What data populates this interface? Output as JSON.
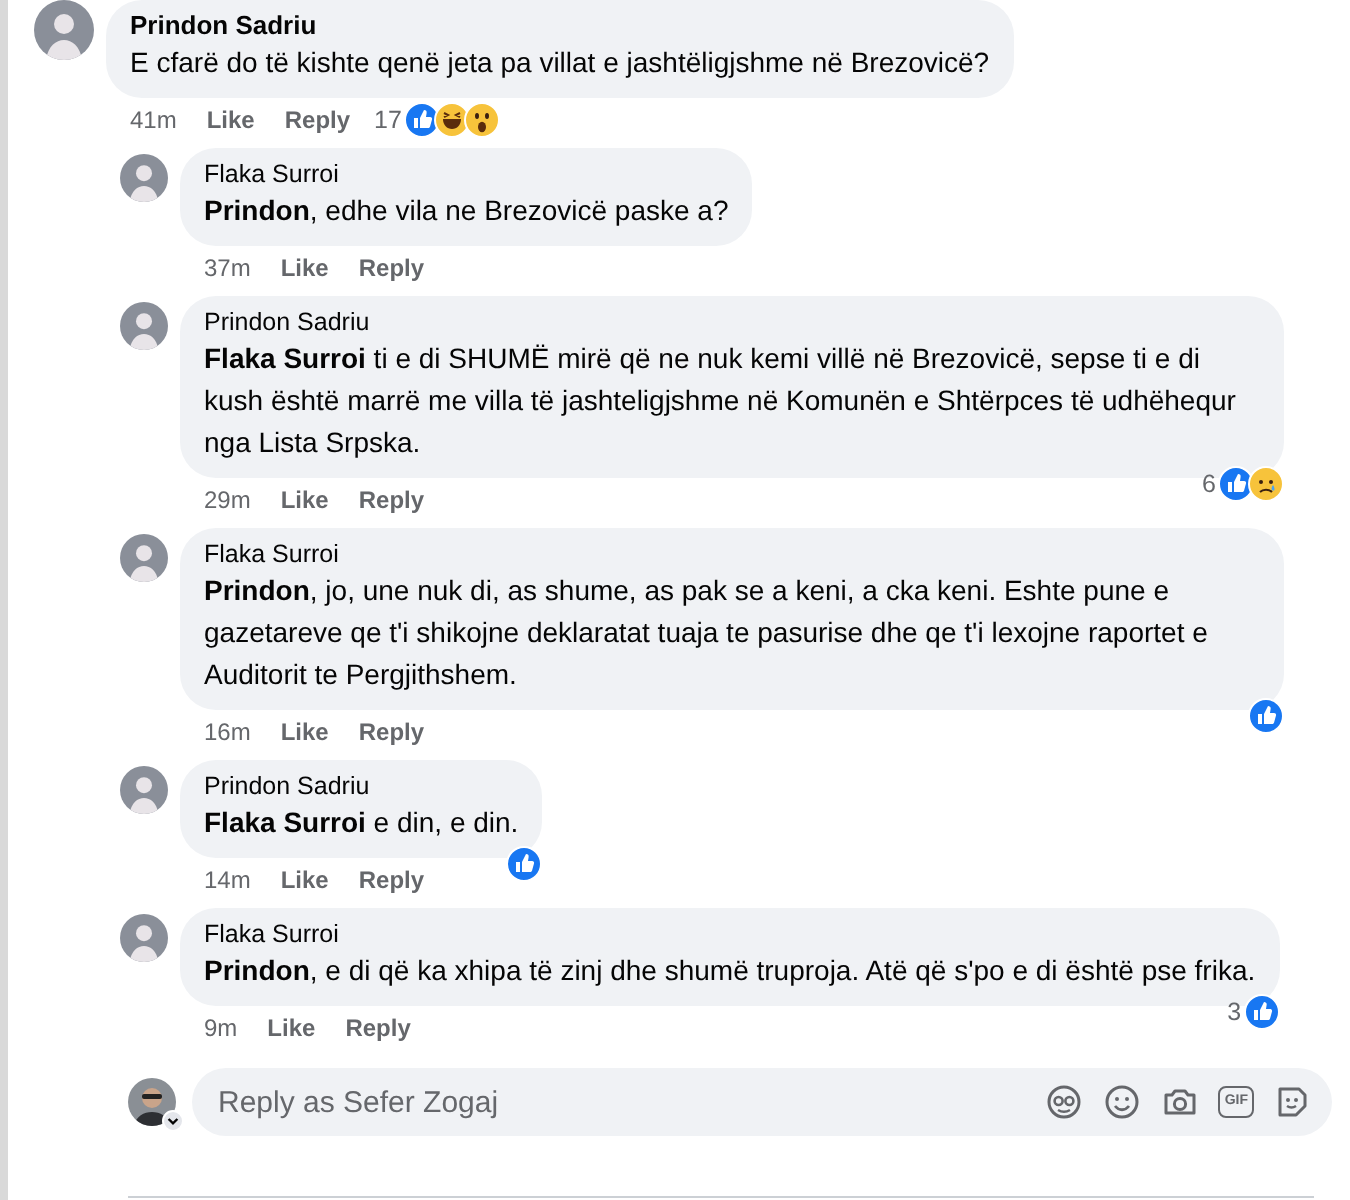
{
  "comments": [
    {
      "author": "Prindon Sadriu",
      "text": "E cfarë do të kishte qenë jeta pa villat e jashtëligjshme në Brezovicë?",
      "nested": false,
      "time": "41m",
      "actions": [
        "Like",
        "Reply"
      ],
      "reactions": {
        "count": "17",
        "icons": [
          {
            "kind": "like"
          },
          {
            "kind": "haha"
          },
          {
            "kind": "wow"
          }
        ]
      }
    },
    {
      "author": "Flaka Surroi",
      "text": "**Prindon**, edhe vila ne Brezovicë paske a?",
      "nested": true,
      "time": "37m",
      "actions": [
        "Like",
        "Reply"
      ]
    },
    {
      "author": "Prindon Sadriu",
      "text": "**Flaka Surroi** ti e di SHUMË mirë që ne nuk kemi villë në Brezovicë, sepse ti e di kush është marrë me villa të jashteligjshme në Komunën e Shtërpces të udhëhequr nga Lista Srpska.",
      "nested": true,
      "time": "29m",
      "actions": [
        "Like",
        "Reply"
      ],
      "reactions": {
        "count": "6",
        "icons": [
          {
            "kind": "like"
          },
          {
            "kind": "sad"
          }
        ]
      }
    },
    {
      "author": "Flaka Surroi",
      "text": "**Prindon**, jo, une nuk di, as shume, as pak se a keni, a cka keni. Eshte pune e gazetareve qe t'i shikojne deklaratat tuaja te pasurise dhe qe t'i lexojne raportet e Auditorit te Pergjithshem.",
      "nested": true,
      "time": "16m",
      "actions": [
        "Like",
        "Reply"
      ],
      "reactions": {
        "icons": [
          {
            "kind": "like"
          }
        ]
      }
    },
    {
      "author": "Prindon Sadriu",
      "text": "**Flaka Surroi** e din, e din.",
      "nested": true,
      "time": "14m",
      "actions": [
        "Like",
        "Reply"
      ],
      "reactions": {
        "icons": [
          {
            "kind": "like"
          }
        ]
      }
    },
    {
      "author": "Flaka Surroi",
      "text": "**Prindon**, e di që ka xhipa të zinj dhe shumë truproja. Atë që s'po e di është pse frika.",
      "nested": true,
      "time": "9m",
      "actions": [
        "Like",
        "Reply"
      ],
      "reactions": {
        "count": "3",
        "icons": [
          {
            "kind": "like"
          }
        ]
      }
    }
  ],
  "reply_box": {
    "placeholder": "Reply as Sefer Zogaj",
    "gif_label": "GIF"
  }
}
